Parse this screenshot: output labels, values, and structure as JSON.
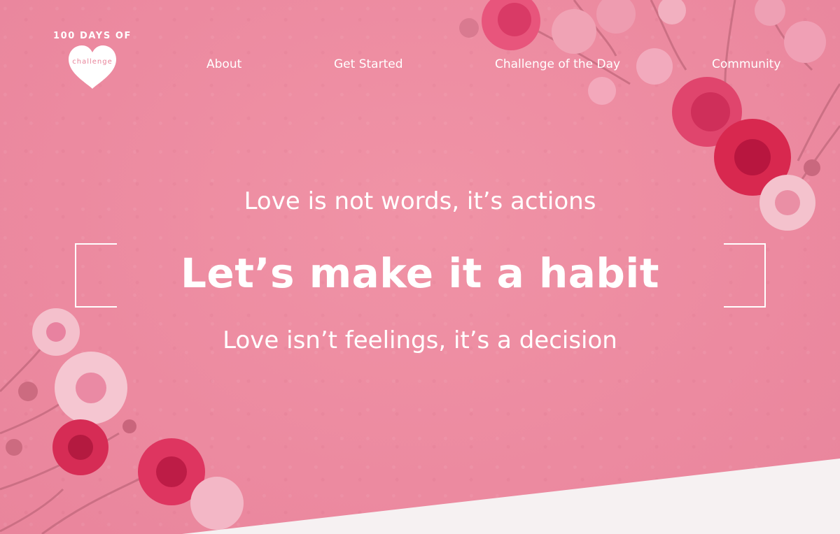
{
  "logo": {
    "top_text": "100 DAYS OF",
    "heart_text": "challenge",
    "heart_icon": "heart-icon"
  },
  "nav": {
    "items": [
      {
        "label": "About"
      },
      {
        "label": "Get Started"
      },
      {
        "label": "Challenge of the Day"
      },
      {
        "label": "Community"
      }
    ]
  },
  "hero": {
    "line1": "Love is not words, it’s actions",
    "headline": "Let’s make it a habit",
    "line3": "Love isn’t feelings, it’s a decision"
  },
  "colors": {
    "background": "#ec8aa0",
    "text": "#ffffff",
    "flower_deep": "#e0305c",
    "flower_pale": "#f7b6c4",
    "bottom_band": "#f6f1f2"
  }
}
